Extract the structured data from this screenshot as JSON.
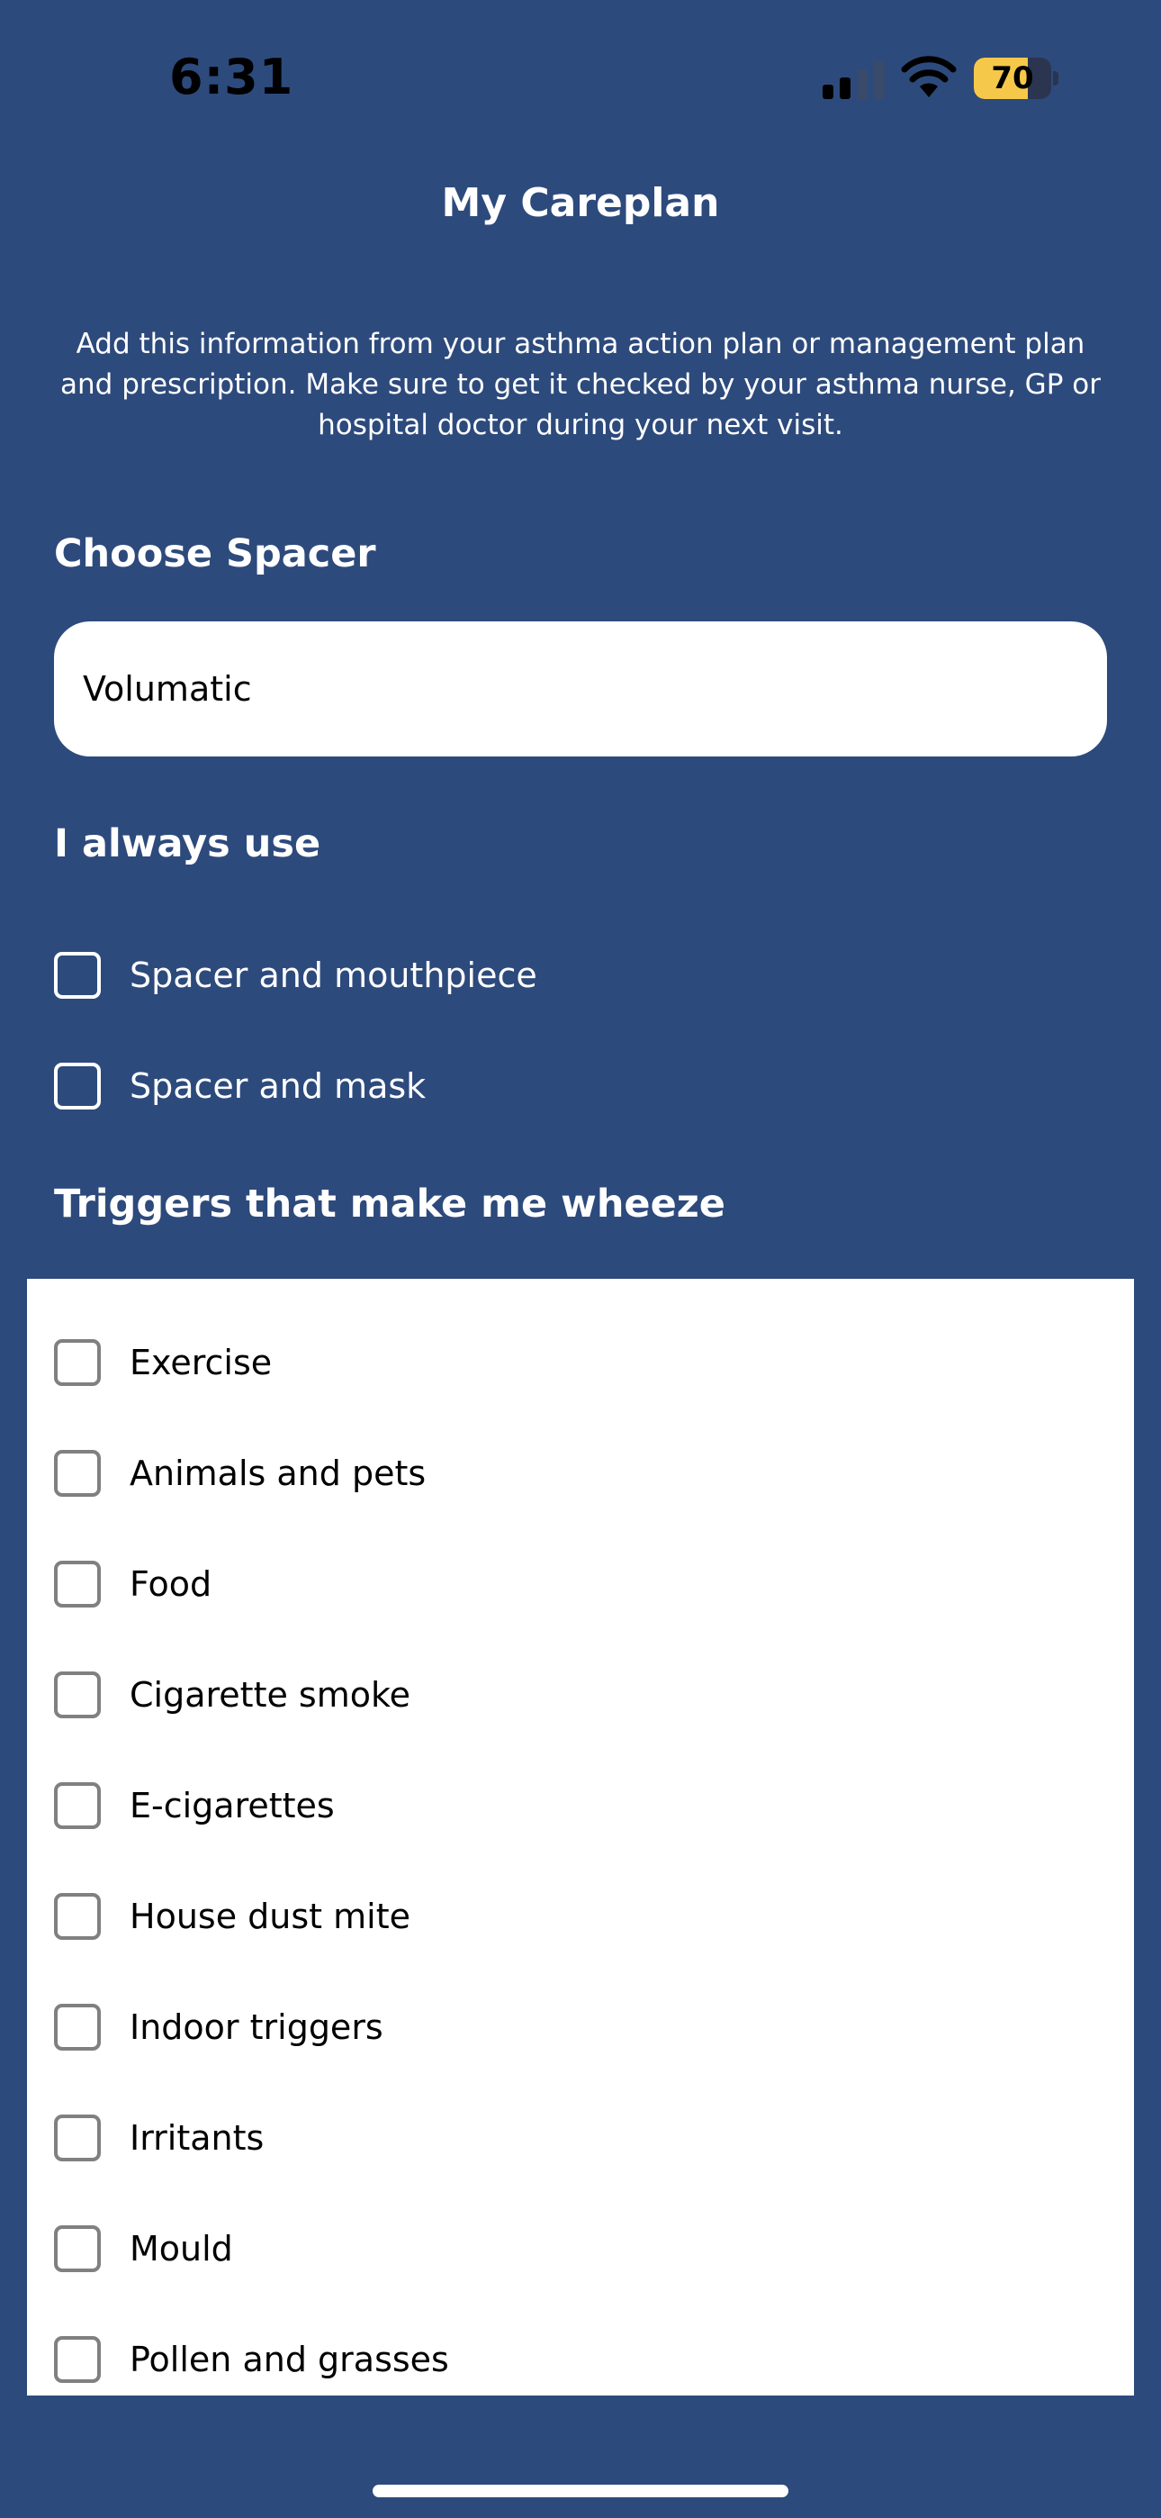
{
  "status_bar": {
    "time": "6:31",
    "battery_level": "70",
    "battery_fraction": 0.7,
    "icons": [
      "signal-icon",
      "wifi-icon",
      "battery-icon"
    ]
  },
  "header": {
    "title": "My Careplan"
  },
  "intro": {
    "text": "Add this information from your asthma action plan or management plan and prescription. Make sure to get it checked by your asthma nurse, GP or hospital doctor during your next visit."
  },
  "spacer": {
    "heading": "Choose Spacer",
    "value": "Volumatic"
  },
  "always_use": {
    "heading": "I always use",
    "options": [
      {
        "label": "Spacer and mouthpiece",
        "checked": false
      },
      {
        "label": "Spacer and mask",
        "checked": false
      }
    ]
  },
  "triggers": {
    "heading": "Triggers that make me wheeze",
    "options": [
      {
        "label": "Exercise",
        "checked": false
      },
      {
        "label": "Animals and pets",
        "checked": false
      },
      {
        "label": "Food",
        "checked": false
      },
      {
        "label": "Cigarette smoke",
        "checked": false
      },
      {
        "label": "E-cigarettes",
        "checked": false
      },
      {
        "label": "House dust mite",
        "checked": false
      },
      {
        "label": "Indoor triggers",
        "checked": false
      },
      {
        "label": "Irritants",
        "checked": false
      },
      {
        "label": "Mould",
        "checked": false
      },
      {
        "label": "Pollen and grasses",
        "checked": false
      }
    ]
  },
  "colors": {
    "background": "#2d4a7c",
    "panel": "#ffffff",
    "battery_fill": "#f6c84a",
    "checkbox_border_dark": "#ffffff",
    "checkbox_border_light": "#808080"
  }
}
